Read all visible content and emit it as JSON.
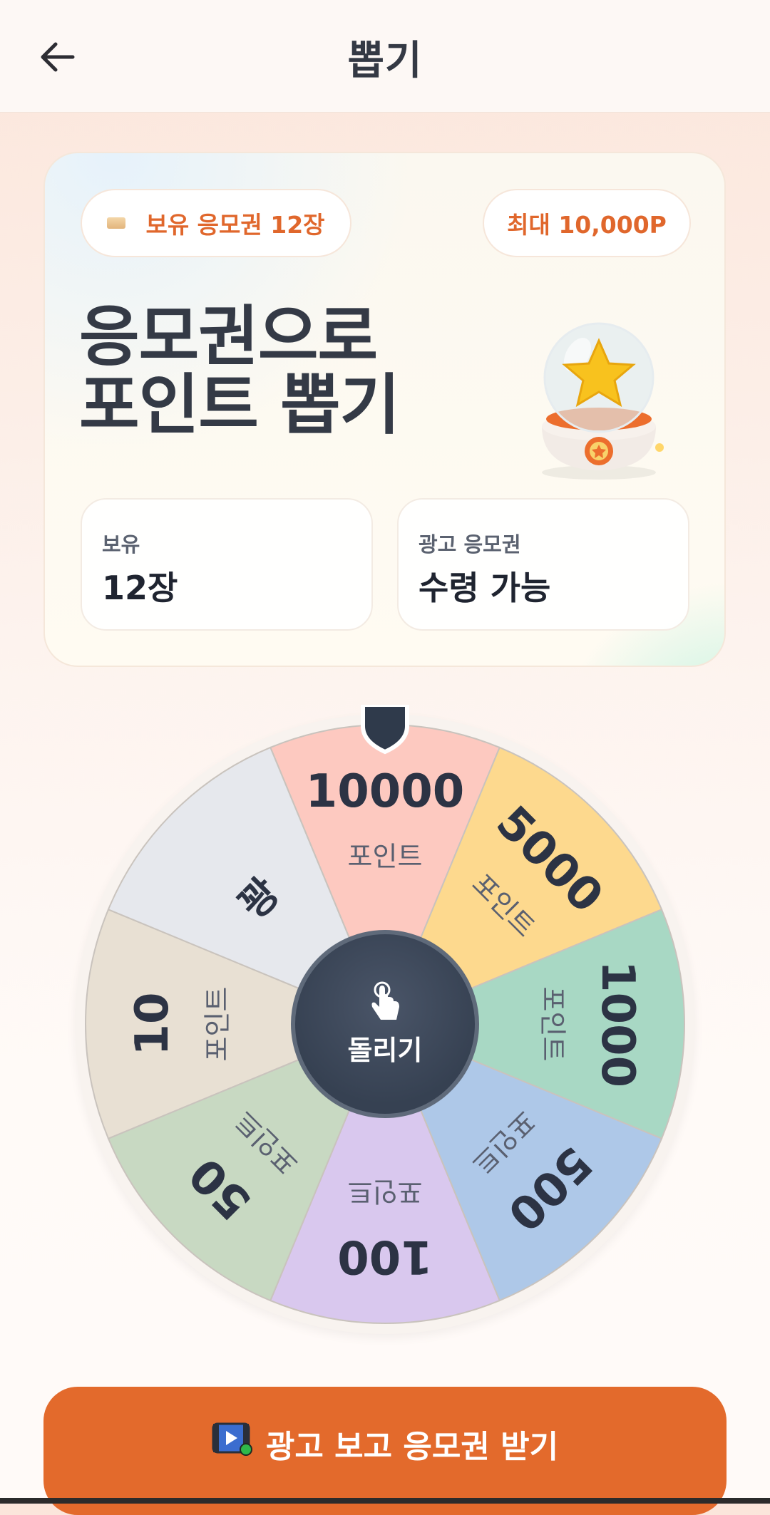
{
  "header": {
    "title": "뽑기",
    "back_icon": "arrow-left-icon"
  },
  "hero": {
    "tickets_pill": "보유 응모권 12장",
    "max_pill": "최대 10,000P",
    "title_line1": "응모권으로",
    "title_line2": "포인트 뽑기",
    "stats": [
      {
        "label": "보유",
        "value": "12장"
      },
      {
        "label": "광고 응모권",
        "value": "수령 가능"
      }
    ]
  },
  "wheel": {
    "unit": "포인트",
    "segments": [
      {
        "value": "10000",
        "color": "#fdc9c0",
        "has_unit": true
      },
      {
        "value": "5000",
        "color": "#fdd98e",
        "has_unit": true
      },
      {
        "value": "1000",
        "color": "#a8d8c4",
        "has_unit": true
      },
      {
        "value": "500",
        "color": "#aec8e8",
        "has_unit": true
      },
      {
        "value": "100",
        "color": "#d9c8ee",
        "has_unit": true
      },
      {
        "value": "50",
        "color": "#c8d9c2",
        "has_unit": true
      },
      {
        "value": "10",
        "color": "#e8e0d3",
        "has_unit": true
      },
      {
        "value": "꽝",
        "color": "#e6e8ed",
        "has_unit": false
      }
    ],
    "spin_label": "돌리기",
    "spin_icon": "tap-hand-icon"
  },
  "ad_button": {
    "label": "광고 보고 응모권 받기",
    "icon": "video-play-icon"
  }
}
